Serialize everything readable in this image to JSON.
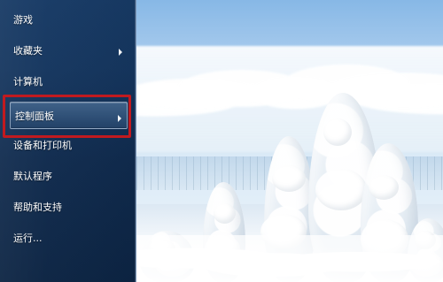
{
  "menu": {
    "items": [
      {
        "label": "游戏",
        "has_submenu": false,
        "selected": false
      },
      {
        "label": "收藏夹",
        "has_submenu": true,
        "selected": false
      },
      {
        "label": "计算机",
        "has_submenu": false,
        "selected": false
      },
      {
        "label": "控制面板",
        "has_submenu": true,
        "selected": true
      },
      {
        "label": "设备和打印机",
        "has_submenu": false,
        "selected": false
      },
      {
        "label": "默认程序",
        "has_submenu": false,
        "selected": false
      },
      {
        "label": "帮助和支持",
        "has_submenu": false,
        "selected": false
      },
      {
        "label": "运行...",
        "has_submenu": false,
        "selected": false
      }
    ]
  },
  "colors": {
    "panel": "#15365f",
    "text": "#ffffff",
    "highlight_border": "#c11a1f",
    "selection_fill": "#234a77",
    "sky": "#87b8e6",
    "snow": "#ffffff"
  },
  "icons": {
    "submenu_arrow": "chevron-right-icon"
  }
}
